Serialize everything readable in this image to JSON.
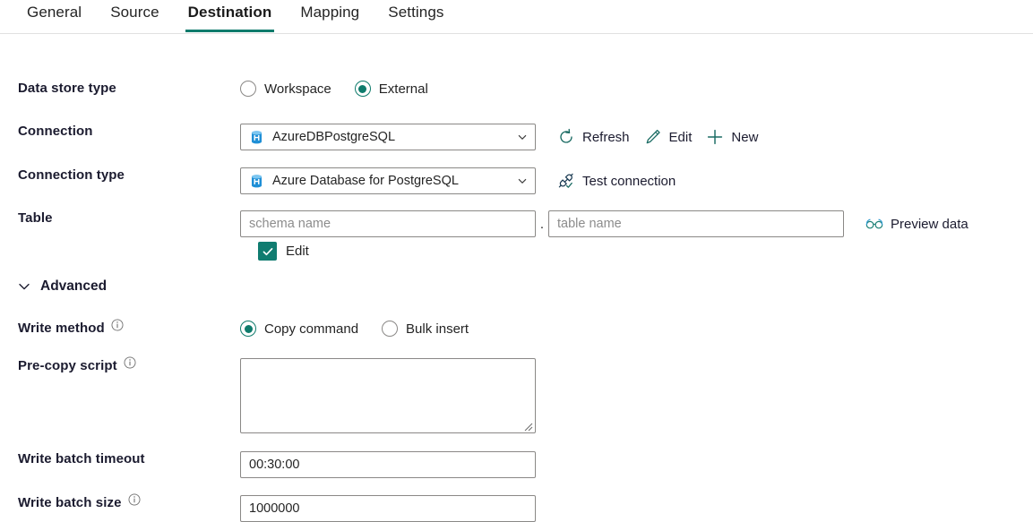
{
  "tabs": [
    {
      "label": "General",
      "active": false
    },
    {
      "label": "Source",
      "active": false
    },
    {
      "label": "Destination",
      "active": true
    },
    {
      "label": "Mapping",
      "active": false
    },
    {
      "label": "Settings",
      "active": false
    }
  ],
  "accent_color": "#0f7b6c",
  "checkbox_color": "#107c70",
  "icon_blue": "#1f8fd6",
  "form": {
    "data_store_type": {
      "label": "Data store type",
      "options": [
        {
          "label": "Workspace",
          "selected": false
        },
        {
          "label": "External",
          "selected": true
        }
      ]
    },
    "connection": {
      "label": "Connection",
      "value": "AzureDBPostgreSQL",
      "icon": "database-icon",
      "actions": [
        {
          "label": "Refresh",
          "icon": "refresh-icon"
        },
        {
          "label": "Edit",
          "icon": "pencil-icon"
        },
        {
          "label": "New",
          "icon": "plus-icon"
        }
      ]
    },
    "connection_type": {
      "label": "Connection type",
      "value": "Azure Database for PostgreSQL",
      "icon": "database-icon",
      "action": {
        "label": "Test connection",
        "icon": "plug-check-icon"
      }
    },
    "table": {
      "label": "Table",
      "schema_placeholder": "schema name",
      "schema_value": "",
      "separator": ".",
      "table_placeholder": "table name",
      "table_value": "",
      "preview": {
        "label": "Preview data",
        "icon": "glasses-icon"
      },
      "edit_checkbox": {
        "label": "Edit",
        "checked": true
      }
    },
    "advanced": {
      "label": "Advanced",
      "expanded": true
    },
    "write_method": {
      "label": "Write method",
      "has_info": true,
      "options": [
        {
          "label": "Copy command",
          "selected": true
        },
        {
          "label": "Bulk insert",
          "selected": false
        }
      ]
    },
    "pre_copy_script": {
      "label": "Pre-copy script",
      "has_info": true,
      "value": ""
    },
    "write_batch_timeout": {
      "label": "Write batch timeout",
      "has_info": false,
      "value": "00:30:00"
    },
    "write_batch_size": {
      "label": "Write batch size",
      "has_info": true,
      "value": "1000000"
    }
  }
}
